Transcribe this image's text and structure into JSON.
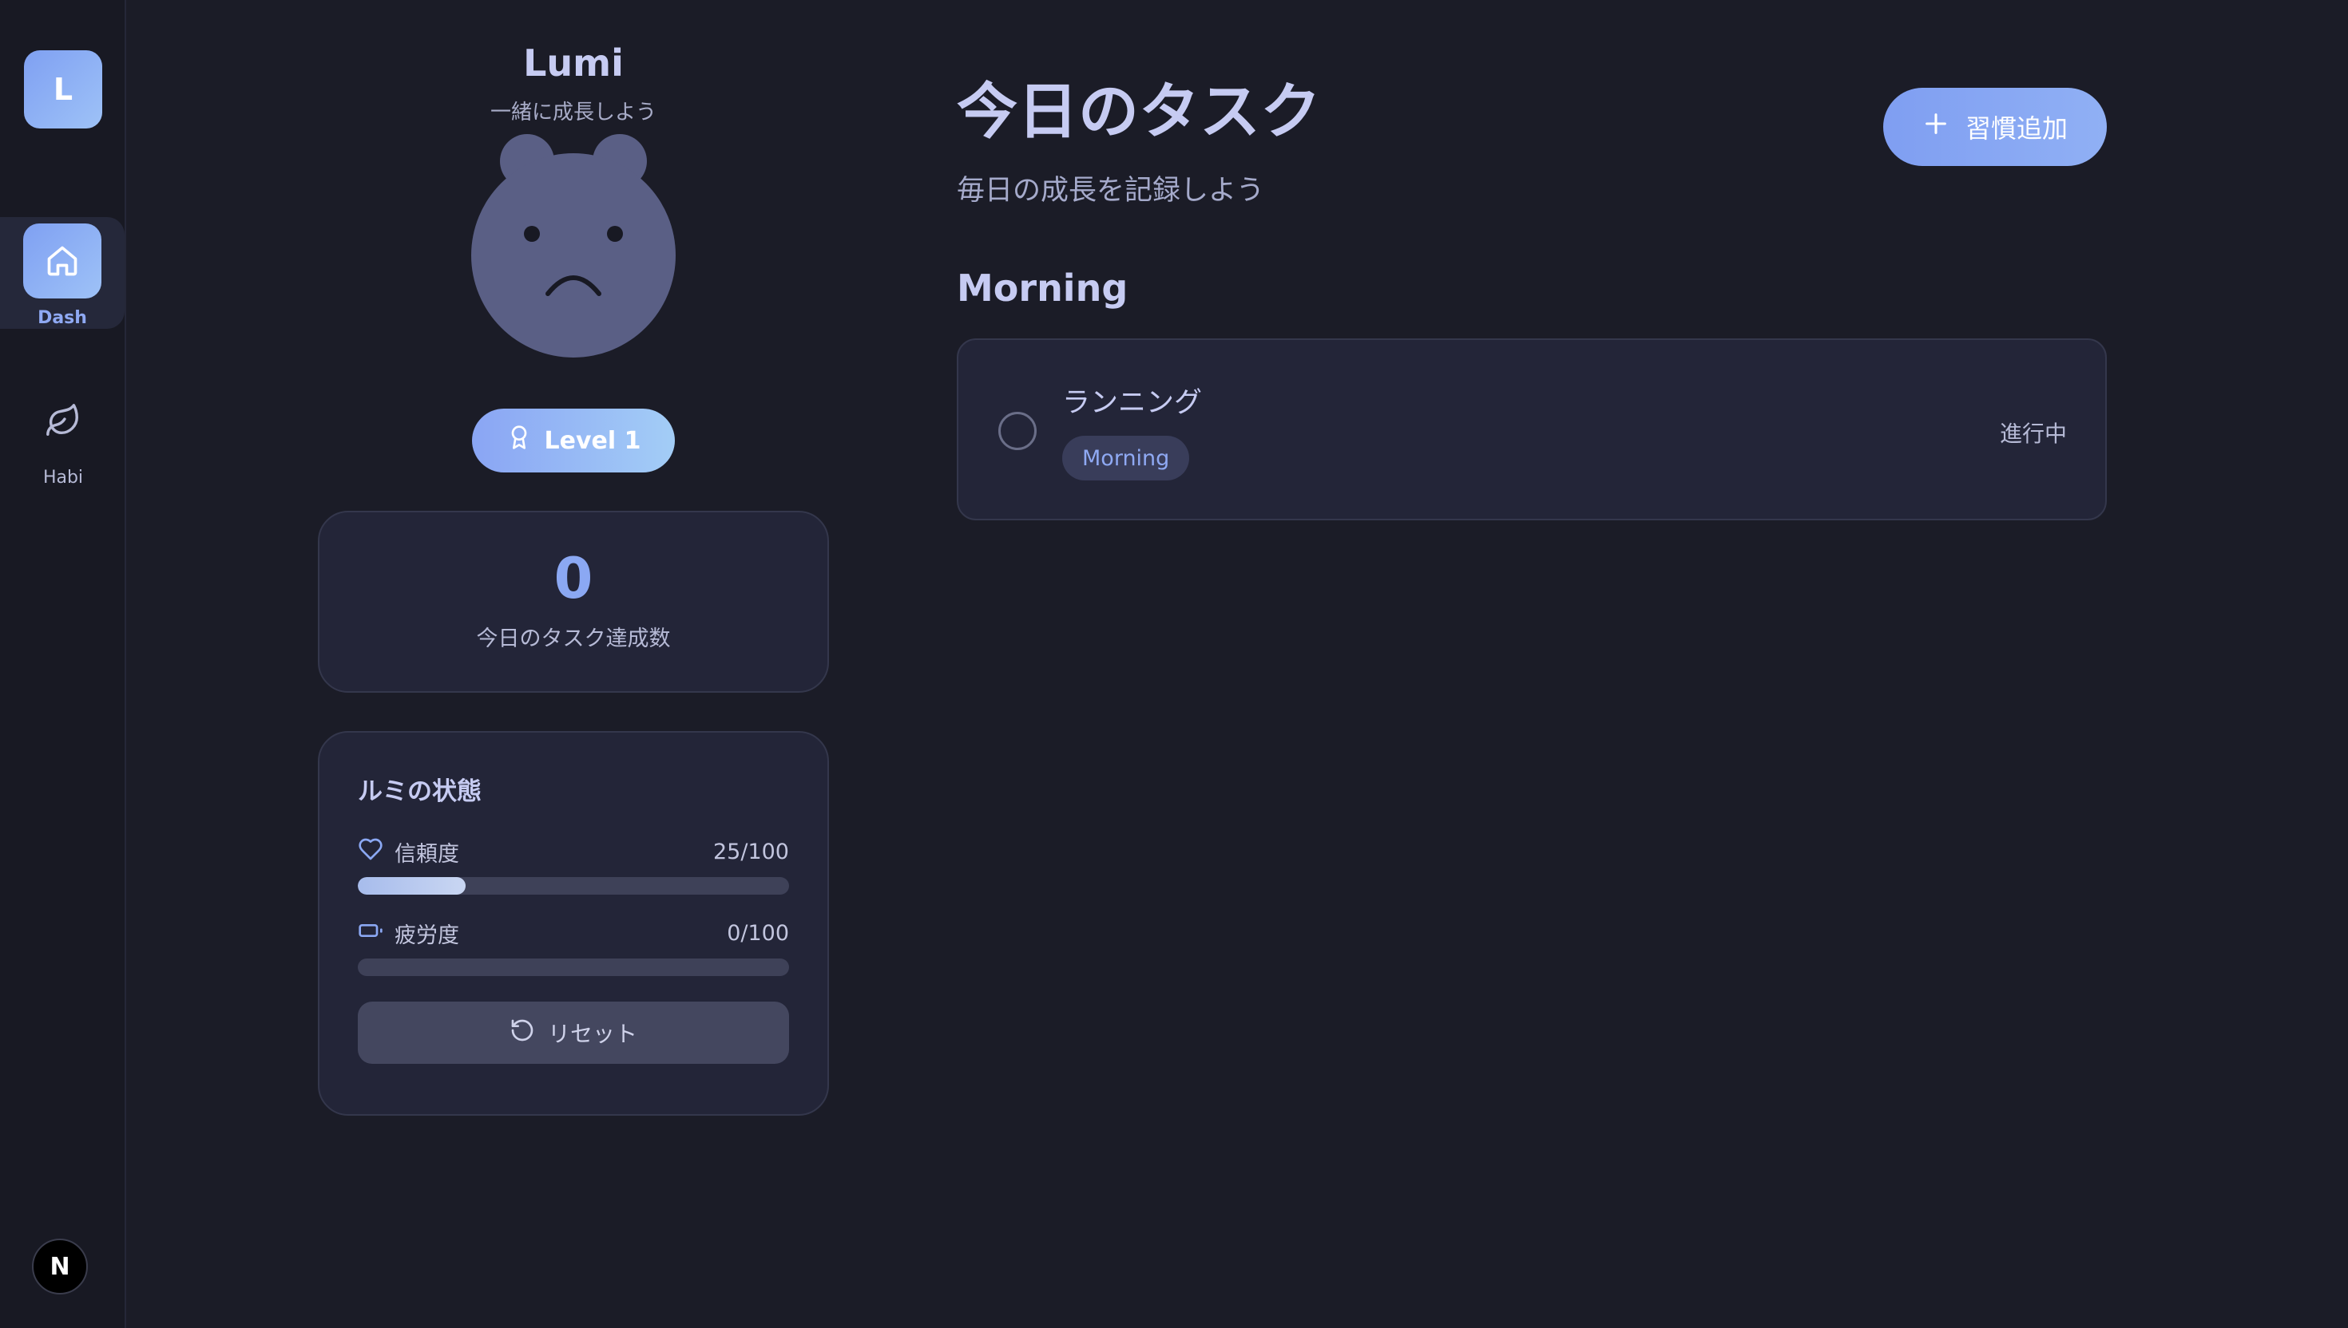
{
  "sidebar": {
    "logo_letter": "L",
    "items": [
      {
        "label": "Dash",
        "icon": "home-icon",
        "active": true
      },
      {
        "label": "Habi",
        "icon": "leaf-icon",
        "active": false
      }
    ],
    "footer_badge": "N"
  },
  "companion": {
    "name": "Lumi",
    "subtitle": "一緒に成長しよう",
    "level_label": "Level 1",
    "today_count": "0",
    "today_count_label": "今日のタスク達成数"
  },
  "status": {
    "title": "ルミの状態",
    "stats": [
      {
        "label": "信頼度",
        "value_text": "25/100",
        "value": 25,
        "max": 100,
        "icon": "heart-icon"
      },
      {
        "label": "疲労度",
        "value_text": "0/100",
        "value": 0,
        "max": 100,
        "icon": "battery-icon"
      }
    ],
    "reset_label": "リセット"
  },
  "main": {
    "title": "今日のタスク",
    "subtitle": "毎日の成長を記録しよう",
    "add_button_label": "習慣追加",
    "sections": [
      {
        "title": "Morning",
        "tasks": [
          {
            "name": "ランニング",
            "tag": "Morning",
            "status": "進行中",
            "done": false
          }
        ]
      }
    ]
  },
  "colors": {
    "background": "#1b1c27",
    "card": "#232538",
    "accent": "#8ba8f3",
    "text": "#c6cbf2"
  }
}
